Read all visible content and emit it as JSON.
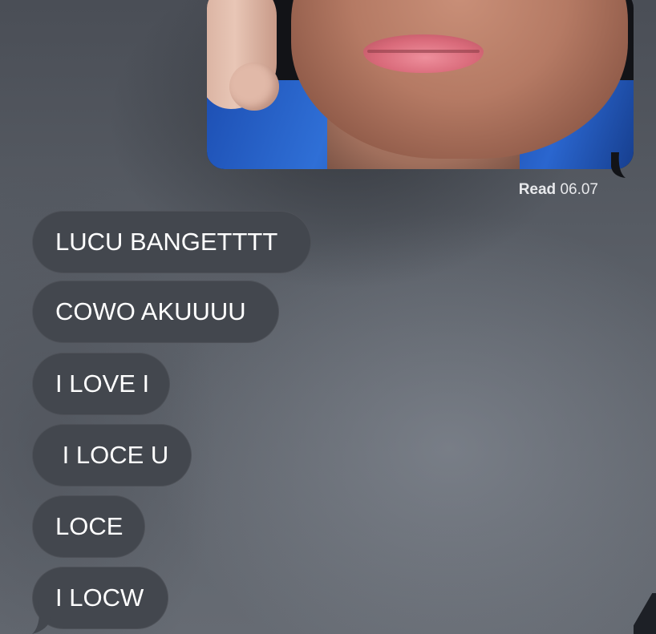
{
  "conversation": {
    "outgoing_photo": {
      "receipt": {
        "label": "Read",
        "time": "06.07"
      }
    },
    "incoming_messages": [
      {
        "text": "LUCU BANGETTTT"
      },
      {
        "text": "COWO AKUUUU"
      },
      {
        "text": "I LOVE I"
      },
      {
        "text": " I LOCE U"
      },
      {
        "text": "LOCE"
      },
      {
        "text": "I LOCW"
      }
    ]
  },
  "colors": {
    "incoming_bubble": "#43474e",
    "outgoing_photo_frame": "#121317",
    "text": "#ffffff",
    "receipt_text": "#e8e9ec"
  }
}
